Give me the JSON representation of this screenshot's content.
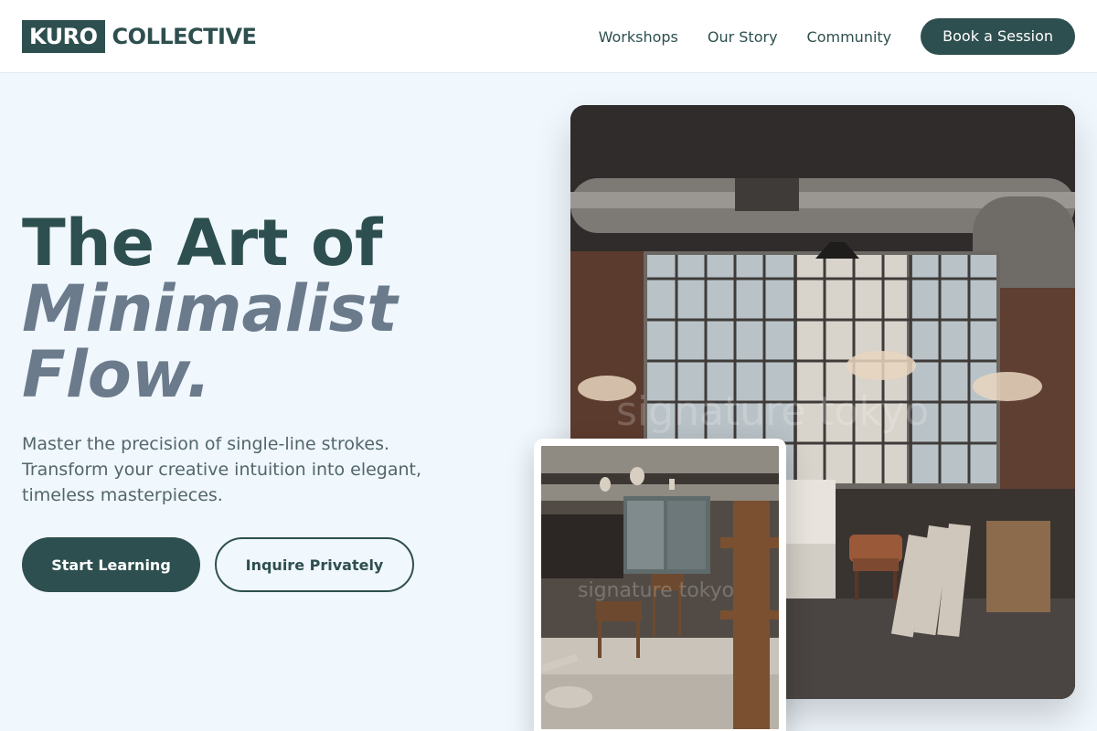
{
  "header": {
    "logo_mark": "KURO",
    "logo_text": "COLLECTIVE",
    "nav": [
      {
        "label": "Workshops"
      },
      {
        "label": "Our Story"
      },
      {
        "label": "Community"
      }
    ],
    "cta_label": "Book a Session"
  },
  "hero": {
    "title_line1": "The Art of",
    "title_line2": "Minimalist Flow.",
    "subtitle": "Master the precision of single-line strokes. Transform your creative intuition into elegant, timeless masterpieces.",
    "primary_button": "Start Learning",
    "secondary_button": "Inquire Privately"
  },
  "images": {
    "main": {
      "subject": "industrial loft studio with tall windows, chandeliers and ducting",
      "watermark": "signature tokyo"
    },
    "inset": {
      "subject": "cluttered artist workshop interior",
      "watermark": "signature tokyo"
    }
  },
  "colors": {
    "brand": "#2e4f4f",
    "accent_text": "#6b7b8c",
    "background": "#f0f7fd"
  }
}
